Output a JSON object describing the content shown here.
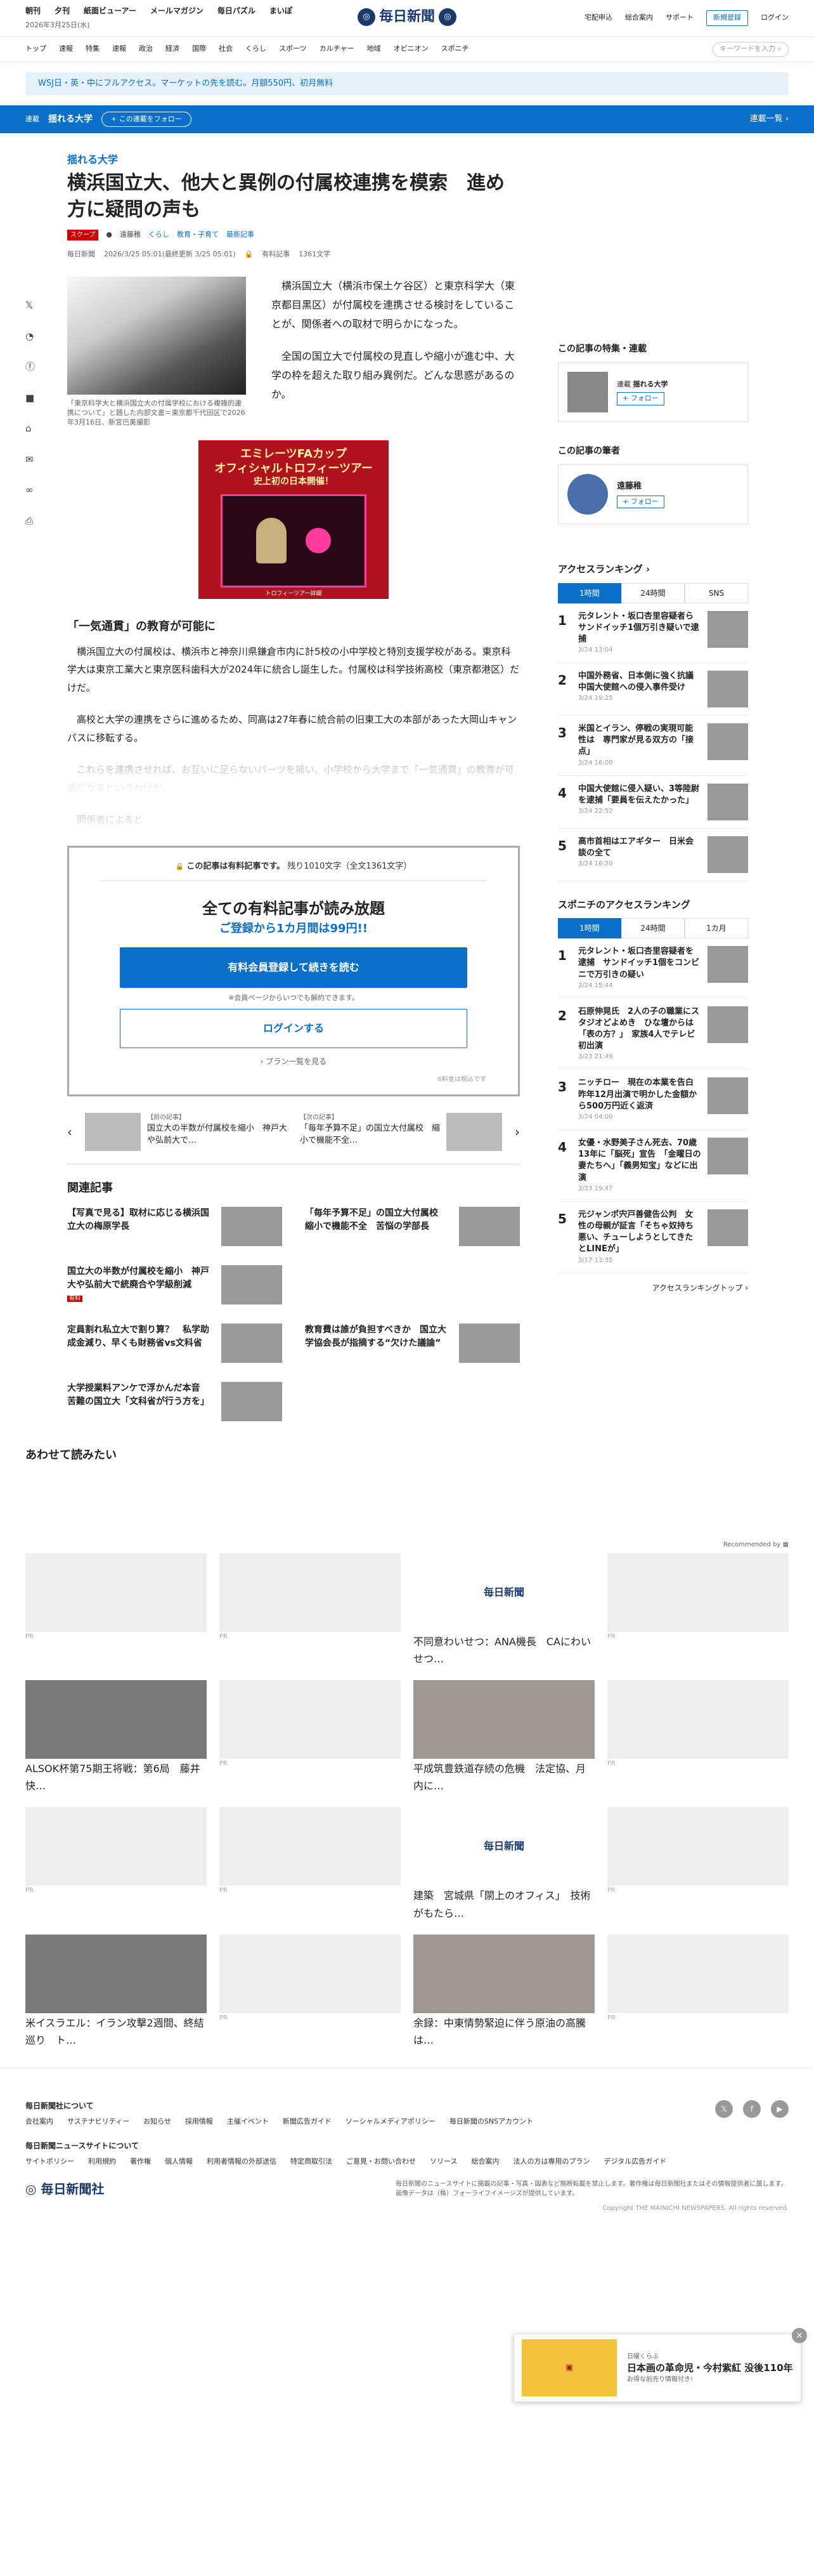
{
  "header": {
    "links": [
      "朝刊",
      "夕刊",
      "紙面ビューアー",
      "メールマガジン",
      "毎日パズル",
      "まいぽ"
    ],
    "date": "2026年3月25日(水)",
    "logo": "毎日新聞",
    "right_links": [
      "宅配申込",
      "総合案内",
      "サポート"
    ],
    "register": "新規登録",
    "login": "ログイン"
  },
  "nav": {
    "items": [
      "トップ",
      "速報",
      "特集",
      "速報",
      "政治",
      "経済",
      "国際",
      "社会",
      "くらし",
      "スポーツ",
      "カルチャー",
      "地域",
      "オピニオン",
      "スポニチ"
    ],
    "search_placeholder": "キーワードを入力"
  },
  "promo": "WSJ日・英・中にフルアクセス。マーケットの先を読む。月額550円、初月無料",
  "serial": {
    "tag": "連載",
    "name": "揺れる大学",
    "follow": "+ この連載をフォロー",
    "all": "連載一覧"
  },
  "article": {
    "category": "揺れる大学",
    "title": "横浜国立大、他大と異例の付属校連携を模索　進め方に疑問の声も",
    "scoop": "スクープ",
    "author": "遠藤稚",
    "tags": [
      "くらし",
      "教育・子育て",
      "最新記事"
    ],
    "publisher": "毎日新聞",
    "date": "2026/3/25 05:01(最終更新 3/25 05:01)",
    "paid": "有料記事",
    "chars": "1361文字",
    "caption": "「東京科学大と横浜国立大の付属学校における複雑的連携について」と題した内部文書＝東京都千代田区で2026年3月16日、新宮巴美撮影",
    "lead": [
      "横浜国立大（横浜市保土ケ谷区）と東京科学大（東京都目黒区）が付属校を連携させる検討をしていることが、関係者への取材で明らかになった。",
      "全国の国立大で付属校の見直しや縮小が進む中、大学の枠を超えた取り組み異例だ。どんな思惑があるのか。"
    ],
    "subhead": "「一気通貫」の教育が可能に",
    "body": [
      "横浜国立大の付属校は、横浜市と神奈川県鎌倉市内に計5校の小中学校と特別支援学校がある。東京科学大は東京工業大と東京医科歯科大が2024年に統合し誕生した。付属校は科学技術高校（東京都港区）だけだ。",
      "高校と大学の連携をさらに進めるため、同高は27年春に統合前の旧東工大の本部があった大岡山キャンパスに移転する。",
      "これらを連携させれば、お互いに足らないパーツを補い、小学校から大学まで「一気通貫」の教育が可能になるというわけだ。"
    ],
    "fade": "関係者によると"
  },
  "ad": {
    "line1": "エミレーツFAカップ",
    "line2": "オフィシャルトロフィーツアー",
    "line3": "史上初の日本開催！",
    "foot": "トロフィーツアー詳細"
  },
  "paywall": {
    "top": "この記事は有料記事です。",
    "remain": "残り1010文字（全文1361文字）",
    "headline": "全ての有料記事が読み放題",
    "sub": "ご登録から1カ月間は99円!!",
    "cta": "有料会員登録して続きを読む",
    "note": "※会員ページからいつでも解約できます。",
    "login": "ログインする",
    "plans": "› プラン一覧を見る",
    "foot": "6料金は税込です"
  },
  "prevnext": [
    {
      "label": "【前の記事】",
      "title": "国立大の半数が付属校を縮小　神戸大や弘前大で…"
    },
    {
      "label": "【次の記事】",
      "title": "「毎年予算不足」の国立大付属校　縮小で機能不全…"
    }
  ],
  "related": {
    "heading": "関連記事",
    "items": [
      {
        "title": "【写真で見る】取材に応じる横浜国立大の梅原学長"
      },
      {
        "title": "「毎年予算不足」の国立大付属校　縮小で機能不全　苦悩の学部長"
      },
      {
        "title": "国立大の半数が付属校を縮小　神戸大や弘前大で統廃合や学級削減",
        "badge": "有料"
      },
      {
        "title": ""
      },
      {
        "title": "定員割れ私立大で割り算？　私学助成金減り、早くも財務省vs文科省"
      },
      {
        "title": "教育費は誰が負担すべきか　国立大学協会長が指摘する“欠けた議論”"
      },
      {
        "title": "大学授業料アンケで浮かんだ本音　苦難の国立大「文科省が行う方を」"
      }
    ]
  },
  "sidebar": {
    "feature_heading": "この記事の特集・連載",
    "feature_tag": "連載",
    "feature_name": "揺れる大学",
    "follow": "+ フォロー",
    "author_heading": "この記事の筆者",
    "author_name": "遠藤稚",
    "ranking_heading": "アクセスランキング",
    "tabs": [
      "1時間",
      "24時間",
      "SNS"
    ],
    "ranking": [
      {
        "n": "1",
        "t": "元タレント・坂口杏里容疑者ら　サンドイッチ1個万引き疑いで逮捕",
        "d": "3/24 13:04"
      },
      {
        "n": "2",
        "t": "中国外務省、日本側に強く抗議　中国大使館への侵入事件受け",
        "d": "3/24 19:25"
      },
      {
        "n": "3",
        "t": "米国とイラン、停戦の実現可能性は　専門家が見る双方の「接点」",
        "d": "3/24 16:00"
      },
      {
        "n": "4",
        "t": "中国大使館に侵入疑い、3等陸尉を逮捕「要員を伝えたかった」",
        "d": "3/24 22:52"
      },
      {
        "n": "5",
        "t": "高市首相はエアギター　日米会談の全て",
        "d": "3/24 16:20"
      }
    ],
    "sponichi_heading": "スポニチのアクセスランキング",
    "sponichi_tabs": [
      "1時間",
      "24時間",
      "1カ月"
    ],
    "sponichi": [
      {
        "n": "1",
        "t": "元タレント・坂口杏里容疑者を逮捕　サンドイッチ1個をコンビニで万引きの疑い",
        "d": "3/24 15:44"
      },
      {
        "n": "2",
        "t": "石原伸晃氏　2人の子の職業にスタジオどよめき　ひな壇からは「表の方？」　家族4人でテレビ初出演",
        "d": "3/23 21:49"
      },
      {
        "n": "3",
        "t": "ニッチロー　現在の本業を告白　昨年12月出演で明かした金額から500万円近く返済",
        "d": "3/24 04:00"
      },
      {
        "n": "4",
        "t": "女優・水野美子さん死去、70歳　13年に「脳死」宣告　「金曜日の妻たちへ」「義男知宝」などに出演",
        "d": "3/23 19:47"
      },
      {
        "n": "5",
        "t": "元ジャンポ宍戸善健告公判　女性の母親が証言「そちゃ奴持ち悪い、チューしようとしてきたとLINEが」",
        "d": "3/17 13:35"
      }
    ],
    "ranking_top": "アクセスランキングトップ"
  },
  "reading": {
    "heading": "あわせて読みたい",
    "recommended": "Recommended by",
    "pr": "PR",
    "cards": [
      {
        "t": ""
      },
      {
        "t": ""
      },
      {
        "t": "不同意わいせつ：ANA機長　CAにわいせつ…",
        "logo": "毎日新聞"
      },
      {
        "t": ""
      },
      {
        "t": "ALSOK杯第75期王将戦：第6局　藤井快…"
      },
      {
        "t": ""
      },
      {
        "t": "平成筑豊鉄道存続の危機　法定協、月内に…"
      },
      {
        "t": ""
      },
      {
        "t": ""
      },
      {
        "t": ""
      },
      {
        "t": "建築　宮城県「閖上のオフィス」　技術がもたら…",
        "logo": "毎日新聞"
      },
      {
        "t": ""
      },
      {
        "t": "米イスラエル：イラン攻撃2週間、終結巡り　ト…"
      },
      {
        "t": ""
      },
      {
        "t": "余録：中東情勢緊迫に伴う原油の高騰は…"
      },
      {
        "t": ""
      }
    ]
  },
  "popup": {
    "label": "日曜くらぶ",
    "title": "日本画の革命児・今村紫紅 没後110年",
    "sub": "お得な前売り情報付き!"
  },
  "footer": {
    "about": "毎日新聞社について",
    "links1": [
      "会社案内",
      "サステナビリティー",
      "お知らせ",
      "採用情報",
      "主催イベント",
      "新聞広告ガイド",
      "ソーシャルメディアポリシー",
      "毎日新聞のSNSアカウント"
    ],
    "sites": "毎日新聞ニュースサイトについて",
    "links2": [
      "サイトポリシー",
      "利用規約",
      "著作権",
      "個人情報",
      "利用者情報の外部送信",
      "特定商取引法",
      "ご意見・お問い合わせ",
      "ソリース",
      "総合案内",
      "法人の方は専用のプラン",
      "デジタル広告ガイド"
    ],
    "logo": "毎日新聞社",
    "note": "毎日新聞のニュースサイトに掲載の記事・写真・図表など無断転載を禁止します。著作権は毎日新聞社またはその情報提供者に属します。画像データは（株）フォーライフイメージズが提供しています。",
    "copyright": "Copyright THE MAINICHI NEWSPAPERS. All rights reserved."
  }
}
